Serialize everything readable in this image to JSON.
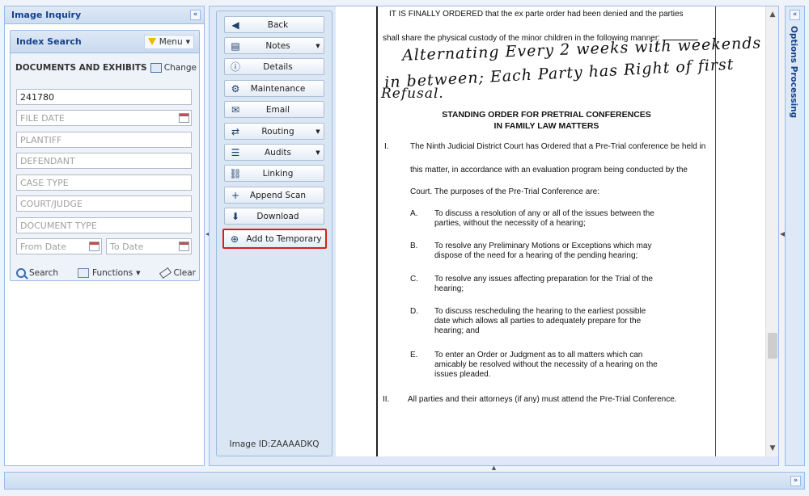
{
  "left_panel": {
    "title": "Image Inquiry",
    "collapse": "«"
  },
  "index_search": {
    "title": "Index Search",
    "menu_label": "Menu",
    "docs_label": "DOCUMENTS AND EXHIBITS",
    "change_label": "Change",
    "case_number": "241780",
    "placeholders": {
      "file_date": "FILE DATE",
      "plantiff": "PLANTIFF",
      "defendant": "DEFENDANT",
      "case_type": "CASE TYPE",
      "court_judge": "COURT/JUDGE",
      "document_type": "DOCUMENT TYPE",
      "from_date": "From Date",
      "to_date": "To Date"
    },
    "search_label": "Search",
    "functions_label": "Functions",
    "clear_label": "Clear"
  },
  "actions": {
    "buttons": [
      {
        "label": "Back",
        "icon": "◀"
      },
      {
        "label": "Notes",
        "icon": "▤"
      },
      {
        "label": "Details",
        "icon": "ⓘ"
      },
      {
        "label": "Maintenance",
        "icon": "⚙"
      },
      {
        "label": "Email",
        "icon": "✉"
      },
      {
        "label": "Routing",
        "icon": "⇄"
      },
      {
        "label": "Audits",
        "icon": "☰"
      },
      {
        "label": "Linking",
        "icon": "⛓"
      },
      {
        "label": "Append Scan",
        "icon": "+"
      },
      {
        "label": "Download",
        "icon": "⬇"
      },
      {
        "label": "Add to Temporary",
        "icon": "⊕"
      }
    ],
    "image_id": "Image ID:ZAAAADKQ"
  },
  "document": {
    "line1": "IT IS FINALLY ORDERED that the ex parte order had been denied and the parties",
    "line2": "shall share the physical custody of the minor children in the following manner:",
    "handwriting": [
      "Alternating Every 2 weeks with weekends",
      "in between; Each Party has Right of first",
      "Refusal."
    ],
    "heading1": "STANDING ORDER FOR PRETRIAL CONFERENCES",
    "heading2": "IN FAMILY LAW MATTERS",
    "section1_num": "I.",
    "section1_lines": [
      "The Ninth Judicial District Court has Ordered that a Pre-Trial conference be held in",
      "this matter, in accordance with an evaluation program being conducted by the",
      "Court.  The purposes of the Pre-Trial Conference are:"
    ],
    "items": [
      {
        "letter": "A.",
        "lines": [
          "To discuss a resolution of any or all of the issues between the",
          "parties, without the necessity of a hearing;"
        ]
      },
      {
        "letter": "B.",
        "lines": [
          "To resolve any Preliminary Motions or Exceptions which may",
          "dispose of the need for a hearing of the pending hearing;"
        ]
      },
      {
        "letter": "C.",
        "lines": [
          "To resolve any issues affecting preparation for the Trial of the",
          "hearing;"
        ]
      },
      {
        "letter": "D.",
        "lines": [
          "To discuss rescheduling the hearing to the earliest possible",
          "date which allows all parties to adequately prepare for the",
          "hearing; and"
        ]
      },
      {
        "letter": "E.",
        "lines": [
          "To enter an Order or Judgment as to all matters which can",
          "amicably be resolved without the necessity of a hearing on the",
          "issues pleaded."
        ]
      }
    ],
    "section2_num": "II.",
    "section2_text": "All parties and their attorneys (if any) must attend the Pre-Trial Conference."
  },
  "right_panel": {
    "title": "Options Processing",
    "collapse": "«"
  },
  "bottom_bar": {
    "expand": "»"
  }
}
